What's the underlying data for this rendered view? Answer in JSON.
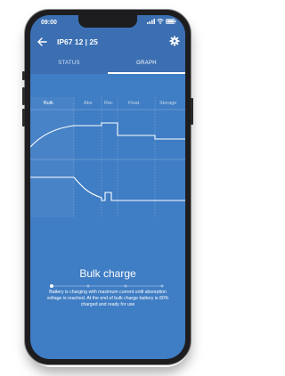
{
  "status_bar": {
    "time": "09:00"
  },
  "header": {
    "title": "IP67 12 | 25"
  },
  "tabs": [
    {
      "label": "STATUS",
      "active": false
    },
    {
      "label": "GRAPH",
      "active": true
    }
  ],
  "graph": {
    "phases": [
      "Bulk",
      "Abs",
      "Rec",
      "Float",
      "Storage"
    ],
    "active_phase": "Bulk"
  },
  "description": {
    "title": "Bulk charge",
    "text": "Battery is charging with maximum current until absorption voltage is reached. At the end of bulk charge battery is 80% charged and ready for use",
    "step": 1,
    "step_count": 4
  },
  "colors": {
    "background": "#3f7dc4",
    "header": "#3b6fb2",
    "text": "#ffffff"
  }
}
